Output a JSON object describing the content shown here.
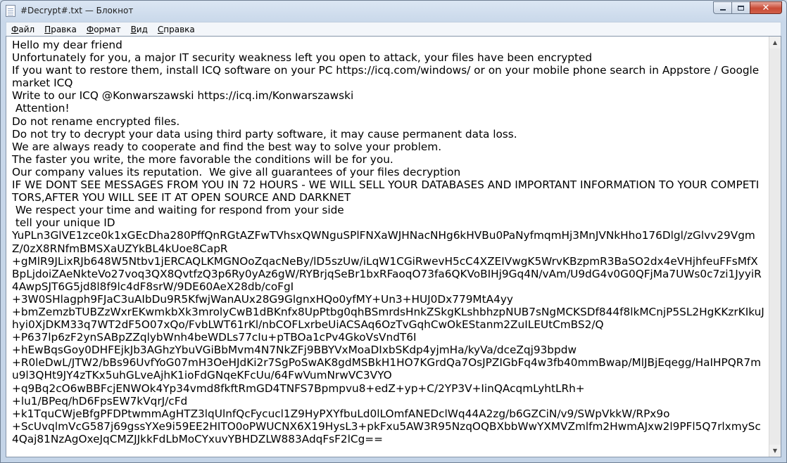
{
  "window": {
    "title": "#Decrypt#.txt — Блокнот",
    "controls": {
      "minimize": "minimize-icon",
      "maximize": "maximize-icon",
      "close": "✕"
    }
  },
  "menu": [
    "Файл",
    "Правка",
    "Формат",
    "Вид",
    "Справка"
  ],
  "document": {
    "lines": [
      "Hello my dear friend",
      "Unfortunately for you, a major IT security weakness left you open to attack, your files have been encrypted",
      "If you want to restore them, install ICQ software on your PC https://icq.com/windows/ or on your mobile phone search in Appstore / Google market ICQ",
      "Write to our ICQ @Konwarszawski https://icq.im/Konwarszawski",
      " Attention!",
      "Do not rename encrypted files.",
      "Do not try to decrypt your data using third party software, it may cause permanent data loss.",
      "We are always ready to cooperate and find the best way to solve your problem.",
      "The faster you write, the more favorable the conditions will be for you.",
      "Our company values its reputation.  We give all guarantees of your files decryption",
      "IF WE DONT SEE MESSAGES FROM YOU IN 72 HOURS - WE WILL SELL YOUR DATABASES AND IMPORTANT INFORMATION TO YOUR COMPETITORS,AFTER YOU WILL SEE IT AT OPEN SOURCE AND DARKNET",
      " We respect your time and waiting for respond from your side",
      " tell your unique ID",
      "YuPLn3GlVE1zce0k1xGEcDha280PffQnRGtAZFwTVhsxQWNguSPlFNXaWJHNacNHg6kHVBu0PaNyfmqmHj3MnJVNkHho176Dlgl/zGlvv29VgmZ/0zX8RNfmBMSXaUZYkBL4kUoe8CapR",
      "+gMlR9JLixRJb648W5Ntbv1jERCAQLKMGNOoZqacNeBy/lD5szUw/iLqW1CGiRwevH5cC4XZEIVwgK5WrvKBzpmR3BaSO2dx4eVHjhfeuFFsMfXBpLjdoiZAeNkteVo27voq3QX8QvtfzQ3p6Ry0yAz6gW/RYBrjqSeBr1bxRFaoqO73fa6QKVoBIHj9Gq4N/vAm/U9dG4v0G0QFjMa7UWs0c7zi1JyyiR4AwpSJT6G5jd8l8f9lc4dF8srW/9DE60AeX28db/coFgI",
      "+3W0SHlagph9FJaC3uAIbDu9R5KfwjWanAUx28G9GlgnxHQo0yfMY+Un3+HUJ0Dx779MtA4yy",
      "+bmZemzbTUBZzWxrEKwmkbXk3mrolyCwB1dBKnfx8UpPtbg0qhBSmrdsHnkZSkgKLshbhzpNUB7sNgMCKSDf844f8lkMCnjP5SL2HgKKzrKIkuJhyi0XjDKM33q7WT2dF5O07xQo/FvbLWT61rKl/nbCOFLxrbeUiACSAq6OzTvGqhCwOkEStanm2ZuILEUtCmBS2/Q",
      "+P637lp6zF2ynSABpZZqlybWnh4beWDLs77cIu+pTBOa1cPv4GkoVsVndT6I",
      "+hEwBqsGoy0DHFEjkJb3AGhzYbuVGiBbMvm4N7NkZFj9BBYVxMoaDIxbSKdp4yjmHa/kyVa/dceZqj93bpdw",
      "+R0leDwL/JTW2/bBs96UvfYoG07mH3OeHJdKi2r7SgPoSwAK8gdMSBkH1HO7KGrdQa7OsJPZIGbFq4w3fb40mmBwap/MlJBjEqegg/HaIHPQR7mu9l3QHt9JY4zTKx5uhGLveAjhK1ioFdGNqeKFcUu/64FwVumNrwVC3VYO",
      "+q9Bq2cO6wBBFcjENWOk4Yp34vmd8fkftRmGD4TNFS7Bpmpvu8+edZ+yp+C/2YP3V+IinQAcqmLyhtLRh+",
      "+lu1/BPeq/hD6FpsEW7kVqrJ/cFd",
      "+k1TquCWjeBfgPFDPtwmmAgHTZ3lqUlnfQcFycucl1Z9HyPXYfbuLd0lLOmfANEDclWq44A2zg/b6GZCiN/v9/SWpVkkW/RPx9o",
      "+ScUvqlmVcG587j69gssYXe9i59EE2HITO0oPWUCNX6X19HysL3+pkFxu5AW3R95NzqOQBXbbWwYXMVZmlfm2HwmAJxw2l9PFl5Q7rlxmySc4Qaj81NzAgOxeJqCMZJJkkFdLbMoCYxuvYBHDZLW883AdqFsF2lCg=="
    ]
  },
  "scrollbar": {
    "up": "▲",
    "down": "▼"
  }
}
